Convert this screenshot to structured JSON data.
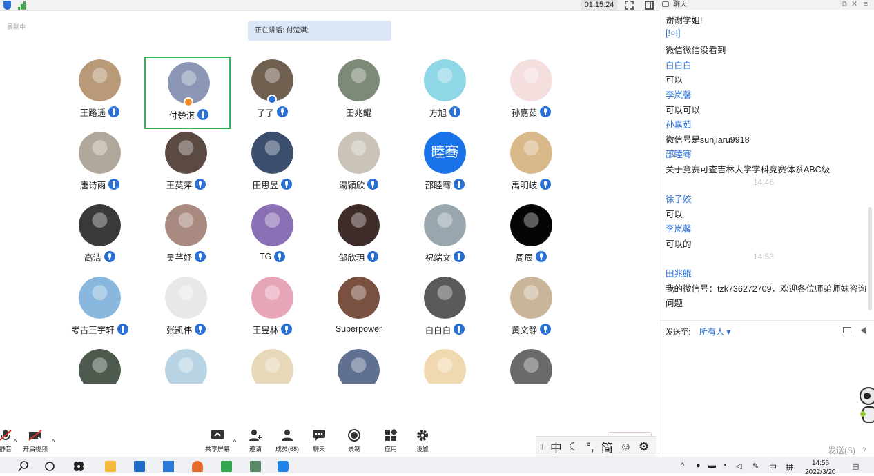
{
  "topbar": {
    "timer": "01:15:24"
  },
  "meeting": {
    "recording_label": "录制中",
    "speaking_banner": "正在讲话: 付楚淇;"
  },
  "participants": [
    {
      "name": "王路遥",
      "mic": true,
      "color": "#b99a78"
    },
    {
      "name": "付楚淇",
      "mic": true,
      "color": "#8a96b4",
      "active": true,
      "badge": "host"
    },
    {
      "name": "了了",
      "mic": true,
      "color": "#6f6050",
      "badge": "cohost"
    },
    {
      "name": "田兆鲲",
      "mic": false,
      "color": "#7d8a77"
    },
    {
      "name": "方旭",
      "mic": true,
      "color": "#8fd6e6"
    },
    {
      "name": "孙嘉茹",
      "mic": true,
      "color": "#f4dede"
    },
    {
      "name": "唐诗雨",
      "mic": true,
      "color": "#b0a89a"
    },
    {
      "name": "王英萍",
      "mic": true,
      "color": "#5a4a42"
    },
    {
      "name": "田思昱",
      "mic": true,
      "color": "#3c4e6e"
    },
    {
      "name": "湯穎欣",
      "mic": true,
      "color": "#c9c3b8"
    },
    {
      "name": "邵睦骞",
      "mic": true,
      "color": "#1a73e8",
      "avatar_text": "睦骞"
    },
    {
      "name": "禹明岐",
      "mic": true,
      "color": "#d9b98a"
    },
    {
      "name": "高洁",
      "mic": true,
      "color": "#3a3a3a"
    },
    {
      "name": "吴芊妤",
      "mic": true,
      "color": "#a88a80"
    },
    {
      "name": "TG",
      "mic": true,
      "color": "#8a6fb4"
    },
    {
      "name": "邹欣玥",
      "mic": true,
      "color": "#3e2c2a"
    },
    {
      "name": "祝端文",
      "mic": true,
      "color": "#9aa6ae"
    },
    {
      "name": "周辰",
      "mic": true,
      "color": "#050505"
    },
    {
      "name": "考古王宇轩",
      "mic": true,
      "color": "#8ab7dd"
    },
    {
      "name": "张凯伟",
      "mic": true,
      "color": "#e8e8e8"
    },
    {
      "name": "王昱林",
      "mic": true,
      "color": "#e7a6b8"
    },
    {
      "name": "Superpower",
      "mic": false,
      "color": "#7a5040"
    },
    {
      "name": "白白白",
      "mic": true,
      "color": "#5a5a5a"
    },
    {
      "name": "黄文静",
      "mic": true,
      "color": "#c9b59a"
    },
    {
      "name": "",
      "mic": false,
      "color": "#4e5a4e"
    },
    {
      "name": "",
      "mic": false,
      "color": "#b8d4e4"
    },
    {
      "name": "",
      "mic": false,
      "color": "#e6d8b8"
    },
    {
      "name": "",
      "mic": false,
      "color": "#607090"
    },
    {
      "name": "",
      "mic": false,
      "color": "#f0d8b0"
    },
    {
      "name": "",
      "mic": false,
      "color": "#6a6a6a"
    }
  ],
  "toolbar": {
    "mute_label": "静音",
    "video_label": "开启视频",
    "share_label": "共享屏幕",
    "invite_label": "邀请",
    "members_label": "成员(68)",
    "chat_label": "聊天",
    "record_label": "录制",
    "apps_label": "应用",
    "settings_label": "设置"
  },
  "ime": {
    "lang": "中",
    "moon": "☾",
    "punct": "°,",
    "simplified": "简",
    "emoji": "☺",
    "gear": "⚙"
  },
  "chat": {
    "title": "聊天",
    "messages": [
      {
        "type": "text",
        "text": "谢谢学姐!"
      },
      {
        "type": "sender",
        "text": "[!○!]"
      },
      {
        "type": "text",
        "text": "微信微信没看到"
      },
      {
        "type": "sender",
        "text": "白白白"
      },
      {
        "type": "text",
        "text": "可以"
      },
      {
        "type": "sender",
        "text": "李岚馨"
      },
      {
        "type": "text",
        "text": "可以可以"
      },
      {
        "type": "sender",
        "text": "孙嘉茹"
      },
      {
        "type": "text",
        "text": "微信号是sunjiaru9918"
      },
      {
        "type": "sender",
        "text": "邵睦骞"
      },
      {
        "type": "text",
        "text": "关于竞赛可查吉林大学学科竞赛体系ABC级"
      },
      {
        "type": "time",
        "text": "14:46"
      },
      {
        "type": "sender",
        "text": "徐子姣"
      },
      {
        "type": "text",
        "text": "可以"
      },
      {
        "type": "sender",
        "text": "李岚馨"
      },
      {
        "type": "text",
        "text": "可以的"
      },
      {
        "type": "time",
        "text": "14:53"
      },
      {
        "type": "sender",
        "text": "田兆鲲"
      },
      {
        "type": "text",
        "text": "我的微信号：tzk736272709，欢迎各位师弟师妹咨询"
      },
      {
        "type": "text",
        "text": "问题"
      }
    ],
    "send_to_label": "发送至:",
    "recipient": "所有人 ▾",
    "send_button": "发送(S)",
    "send_chevron": "∨"
  },
  "taskbar": {
    "time": "14:56",
    "date": "2022/3/20",
    "tray_lang": "中",
    "tray_input": "拼"
  }
}
